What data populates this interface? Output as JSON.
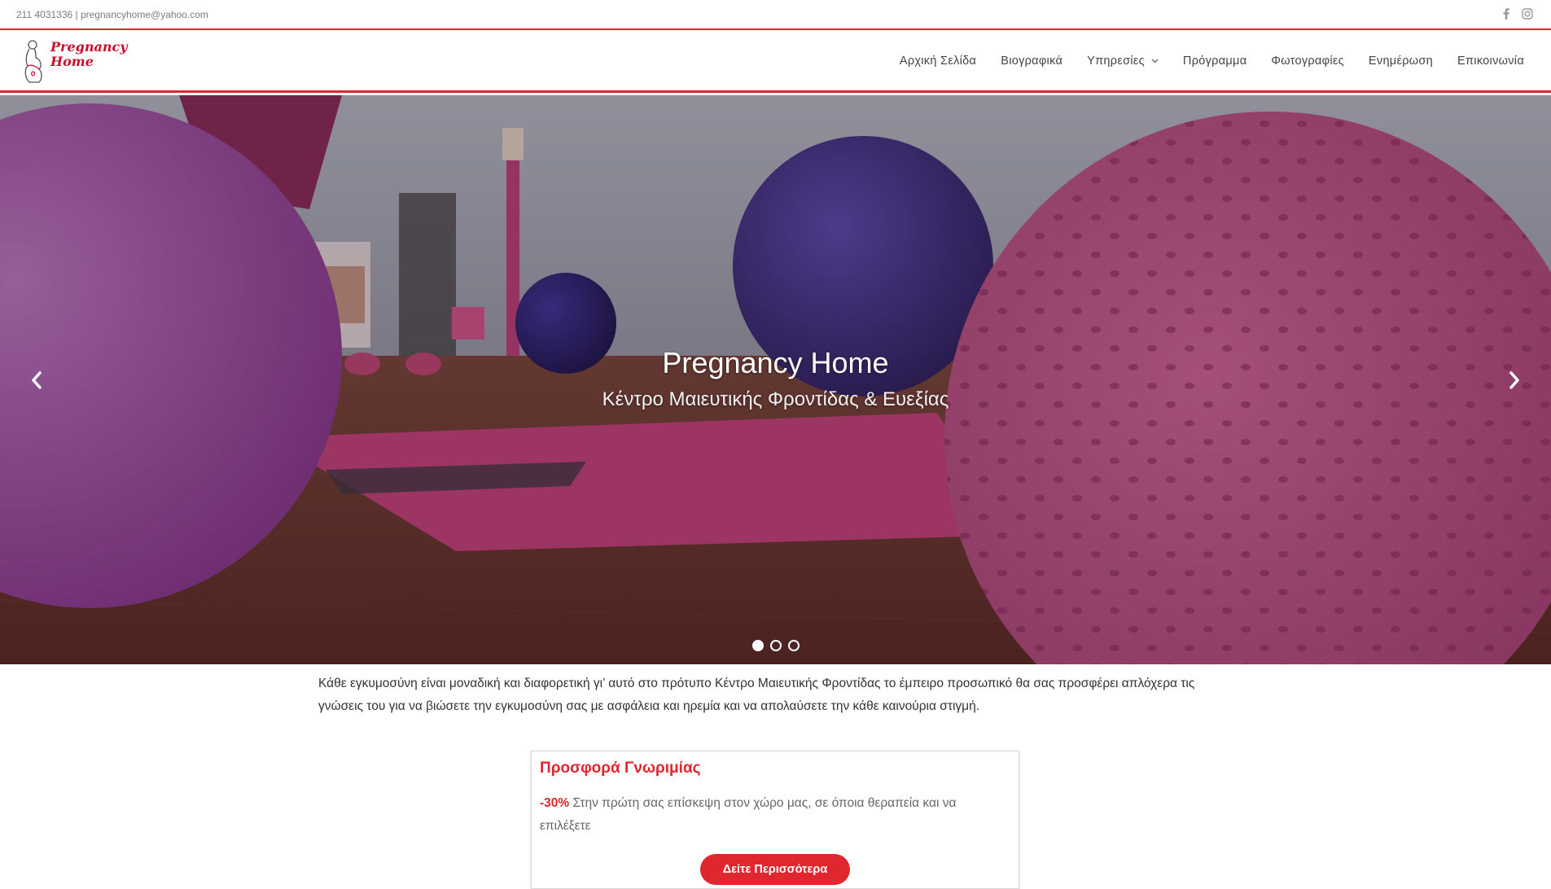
{
  "topbar": {
    "contact": "211 4031336 | pregnancyhome@yahoo.com",
    "social": [
      "facebook-icon",
      "instagram-icon"
    ]
  },
  "header": {
    "logo_line1": "Pregnancy",
    "logo_line2": "Home",
    "nav": [
      {
        "label": "Αρχική Σελίδα"
      },
      {
        "label": "Βιογραφικά"
      },
      {
        "label": "Υπηρεσίες"
      },
      {
        "label": "Πρόγραμμα"
      },
      {
        "label": "Φωτογραφίες"
      },
      {
        "label": "Ενημέρωση"
      },
      {
        "label": "Επικοινωνία"
      }
    ]
  },
  "hero": {
    "title": "Pregnancy Home",
    "subtitle": "Κέντρο Μαιευτικής Φροντίδας & Ευεξίας",
    "slides": 3,
    "active_slide": 1
  },
  "intro": {
    "text": "Κάθε εγκυμοσύνη είναι μοναδική και διαφορετική γι’ αυτό στο πρότυπο Κέντρο Μαιευτικής Φροντίδας το έμπειρο προσωπικό θα σας προσφέρει απλόχερα τις γνώσεις του για να βιώσετε την εγκυμοσύνη σας με ασφάλεια και ηρεμία και να απολαύσετε την κάθε καινούρια στιγμή."
  },
  "offer": {
    "title": "Προσφορά Γνωριμίας",
    "discount": "-30%",
    "text": " Στην πρώτη σας επίσκεψη στον χώρο μας, σε όποια θεραπεία και να επιλέξετε",
    "button": "Δείτε Περισσότερα"
  },
  "colors": {
    "accent": "#e0262e"
  }
}
